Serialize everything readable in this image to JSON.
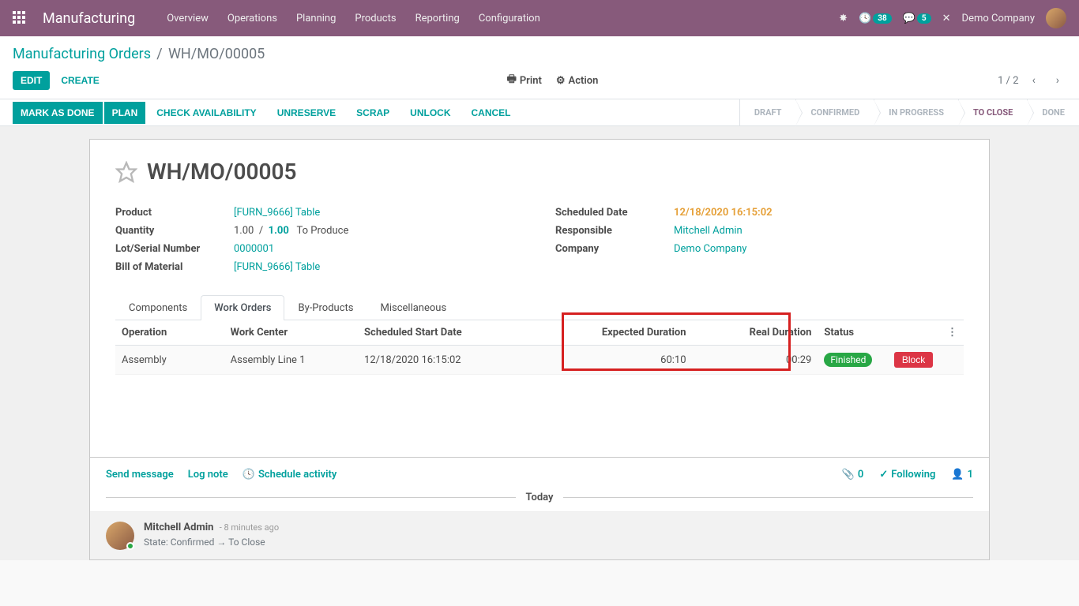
{
  "navbar": {
    "brand": "Manufacturing",
    "menu": [
      "Overview",
      "Operations",
      "Planning",
      "Products",
      "Reporting",
      "Configuration"
    ],
    "badge_clock": "38",
    "badge_chat": "5",
    "company": "Demo Company"
  },
  "breadcrumb": {
    "root": "Manufacturing Orders",
    "current": "WH/MO/00005"
  },
  "controlpanel": {
    "edit": "EDIT",
    "create": "CREATE",
    "print": "Print",
    "action": "Action",
    "pager": "1 / 2"
  },
  "statusbar": {
    "buttons": [
      "MARK AS DONE",
      "PLAN",
      "CHECK AVAILABILITY",
      "UNRESERVE",
      "SCRAP",
      "UNLOCK",
      "CANCEL"
    ],
    "stages": [
      "DRAFT",
      "CONFIRMED",
      "IN PROGRESS",
      "TO CLOSE",
      "DONE"
    ],
    "active_index": 3
  },
  "form": {
    "title": "WH/MO/00005",
    "left": {
      "product_label": "Product",
      "product_val": "[FURN_9666] Table",
      "qty_label": "Quantity",
      "qty_val1": "1.00",
      "qty_sep": "/",
      "qty_val2": "1.00",
      "qty_suffix": "To Produce",
      "lot_label": "Lot/Serial Number",
      "lot_val": "0000001",
      "bom_label": "Bill of Material",
      "bom_val": "[FURN_9666] Table"
    },
    "right": {
      "sched_label": "Scheduled Date",
      "sched_val": "12/18/2020 16:15:02",
      "resp_label": "Responsible",
      "resp_val": "Mitchell Admin",
      "company_label": "Company",
      "company_val": "Demo Company"
    }
  },
  "tabs": [
    "Components",
    "Work Orders",
    "By-Products",
    "Miscellaneous"
  ],
  "active_tab": 1,
  "table": {
    "headers": {
      "operation": "Operation",
      "workcenter": "Work Center",
      "scheduled": "Scheduled Start Date",
      "expected": "Expected Duration",
      "real": "Real Duration",
      "status": "Status"
    },
    "row": {
      "operation": "Assembly",
      "workcenter": "Assembly Line 1",
      "scheduled": "12/18/2020 16:15:02",
      "expected": "60:10",
      "real": "00:29",
      "status": "Finished",
      "block": "Block"
    }
  },
  "chatter": {
    "send": "Send message",
    "lognote": "Log note",
    "schedule": "Schedule activity",
    "attach_count": "0",
    "following": "Following",
    "followers": "1",
    "separator": "Today",
    "author": "Mitchell Admin",
    "time": "- 8 minutes ago",
    "change": "State: Confirmed → To Close"
  }
}
